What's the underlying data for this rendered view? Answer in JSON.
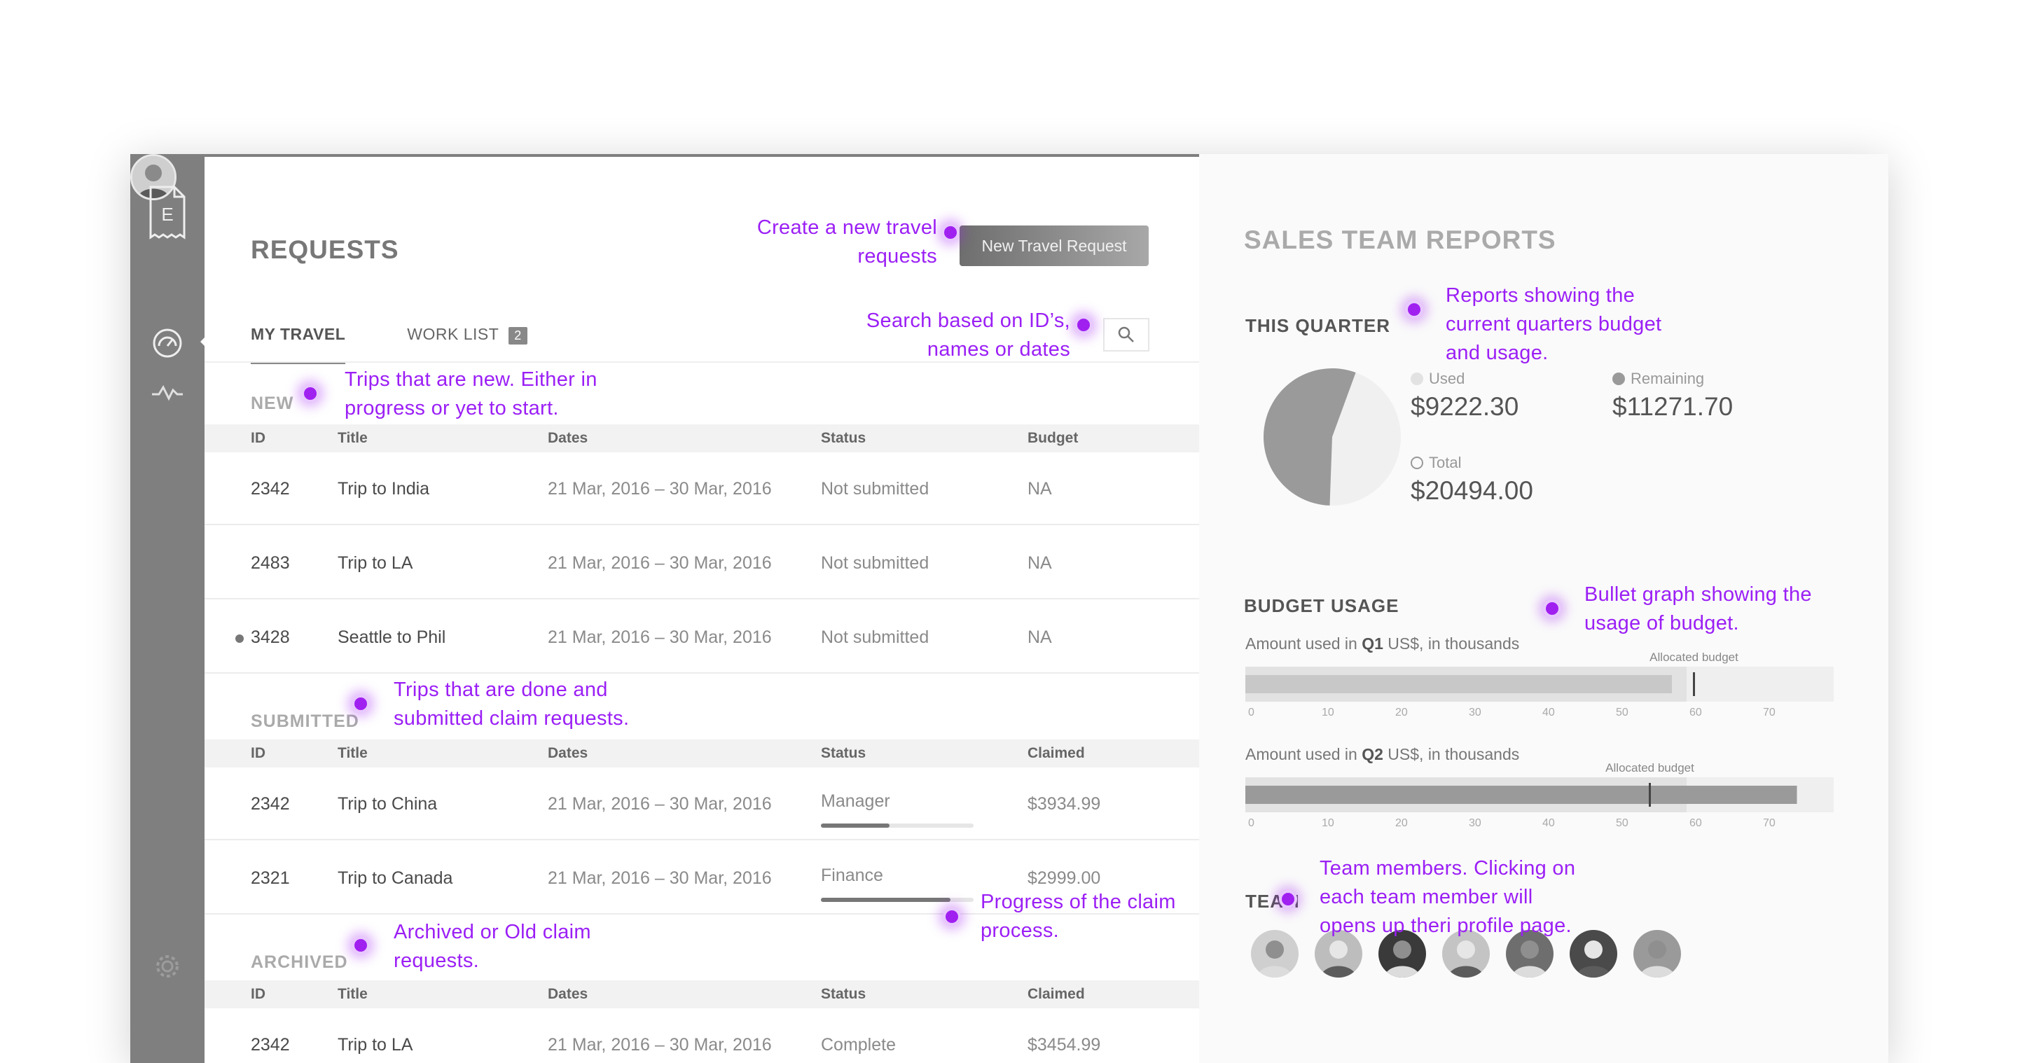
{
  "sidebar": {
    "logo_letter": "E"
  },
  "requests": {
    "title": "REQUESTS",
    "new_button": "New Travel Request",
    "tabs": [
      {
        "label": "MY TRAVEL"
      },
      {
        "label": "WORK LIST",
        "badge": "2"
      }
    ],
    "new_section": {
      "label": "NEW",
      "headers": [
        "ID",
        "Title",
        "Dates",
        "Status",
        "Budget"
      ],
      "rows": [
        {
          "id": "2342",
          "title": "Trip to India",
          "dates": "21 Mar, 2016 – 30 Mar, 2016",
          "status": "Not submitted",
          "budget": "NA"
        },
        {
          "id": "2483",
          "title": "Trip to LA",
          "dates": "21 Mar, 2016 – 30 Mar, 2016",
          "status": "Not submitted",
          "budget": "NA"
        },
        {
          "id": "3428",
          "title": "Seattle to Phil",
          "dates": "21 Mar, 2016 – 30 Mar, 2016",
          "status": "Not submitted",
          "budget": "NA"
        }
      ]
    },
    "submitted_section": {
      "label": "SUBMITTED",
      "headers": [
        "ID",
        "Title",
        "Dates",
        "Status",
        "Claimed"
      ],
      "rows": [
        {
          "id": "2342",
          "title": "Trip to China",
          "dates": "21 Mar, 2016 – 30 Mar, 2016",
          "status": "Manager",
          "claimed": "$3934.99",
          "progress": 0.45
        },
        {
          "id": "2321",
          "title": "Trip to Canada",
          "dates": "21 Mar, 2016 – 30 Mar, 2016",
          "status": "Finance",
          "claimed": "$2999.00",
          "progress": 0.85
        }
      ]
    },
    "archived_section": {
      "label": "ARCHIVED",
      "headers": [
        "ID",
        "Title",
        "Dates",
        "Status",
        "Claimed"
      ],
      "rows": [
        {
          "id": "2342",
          "title": "Trip to LA",
          "dates": "21 Mar, 2016 – 30 Mar, 2016",
          "status": "Complete",
          "claimed": "$3454.99"
        }
      ]
    }
  },
  "reports": {
    "title": "SALES TEAM REPORTS",
    "this_quarter": {
      "label": "THIS QUARTER",
      "used_label": "Used",
      "used_value": "$9222.30",
      "remaining_label": "Remaining",
      "remaining_value": "$11271.70",
      "total_label": "Total",
      "total_value": "$20494.00"
    },
    "budget_usage": {
      "label": "BUDGET USAGE",
      "q1_prefix": "Amount used in ",
      "q1_q": "Q1",
      "q1_suffix": " US$, in thousands",
      "q2_prefix": "Amount used in ",
      "q2_q": "Q2",
      "q2_suffix": " US$, in thousands",
      "allocated_label": "Allocated budget"
    },
    "team_label": "TEAM",
    "team_count": 7
  },
  "chart_data": [
    {
      "type": "pie",
      "labels": [
        "Used",
        "Remaining"
      ],
      "values": [
        9222.3,
        11271.7
      ],
      "colors": [
        "#f0f0f0",
        "#9a9a9a"
      ]
    },
    {
      "type": "bar",
      "categories": [
        "Q1",
        "Q2"
      ],
      "series": [
        {
          "name": "Amount used",
          "values": [
            58,
            75
          ]
        },
        {
          "name": "Allocated budget",
          "values": [
            61,
            55
          ]
        }
      ],
      "xlim": [
        0,
        80
      ],
      "ticks": [
        0,
        10,
        20,
        30,
        40,
        50,
        60,
        70
      ],
      "xlabel": "US$, in thousands"
    }
  ],
  "annotations": {
    "new_request": "Create a new travel\nrequests",
    "search": "Search based on ID’s,\nnames or dates",
    "new_trips": "Trips that are new. Either in\nprogress or yet to start.",
    "submitted": "Trips that are done and\nsubmitted claim requests.",
    "progress": "Progress of the claim\nprocess.",
    "archived": "Archived or Old claim\nrequests.",
    "reports": "Reports showing the\ncurrent quarters budget\nand usage.",
    "bullet": "Bullet graph showing the\nusage of budget.",
    "team": "Team members. Clicking on\neach team member will\nopens up theri profile page."
  },
  "colors": {
    "annotation": "#9b1ff5",
    "sidebar": "#7f7f7f"
  }
}
